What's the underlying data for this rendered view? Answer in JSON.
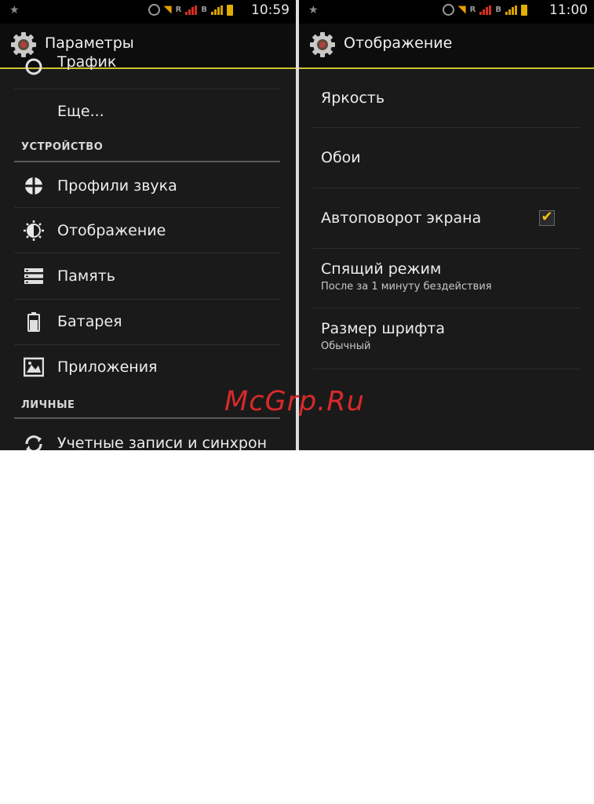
{
  "left": {
    "status": {
      "time": "10:59",
      "net1": "R",
      "net2": "B"
    },
    "title": "Параметры",
    "top_partial": "Трафик",
    "more": "Еще...",
    "section_device": "УСТРОЙСТВО",
    "items": [
      {
        "label": "Профили звука",
        "icon": "sound-profiles-icon"
      },
      {
        "label": "Отображение",
        "icon": "display-icon"
      },
      {
        "label": "Память",
        "icon": "storage-icon"
      },
      {
        "label": "Батарея",
        "icon": "battery-icon"
      },
      {
        "label": "Приложения",
        "icon": "apps-icon"
      }
    ],
    "section_personal": "ЛИЧНЫЕ",
    "accounts": "Учетные записи и синхрон"
  },
  "right": {
    "status": {
      "time": "11:00",
      "net1": "R",
      "net2": "B"
    },
    "title": "Отображение",
    "brightness": "Яркость",
    "wallpaper": "Обои",
    "autorotate": "Автоповорот экрана",
    "autorotate_checked": true,
    "sleep": "Спящий режим",
    "sleep_sub": "После за 1 минуту бездействия",
    "font_size": "Размер шрифта",
    "font_size_sub": "Обычный"
  },
  "watermark": "McGrp.Ru",
  "colors": {
    "accent": "#c9c230",
    "check": "#f2c010",
    "watermark": "#d82a2a"
  }
}
